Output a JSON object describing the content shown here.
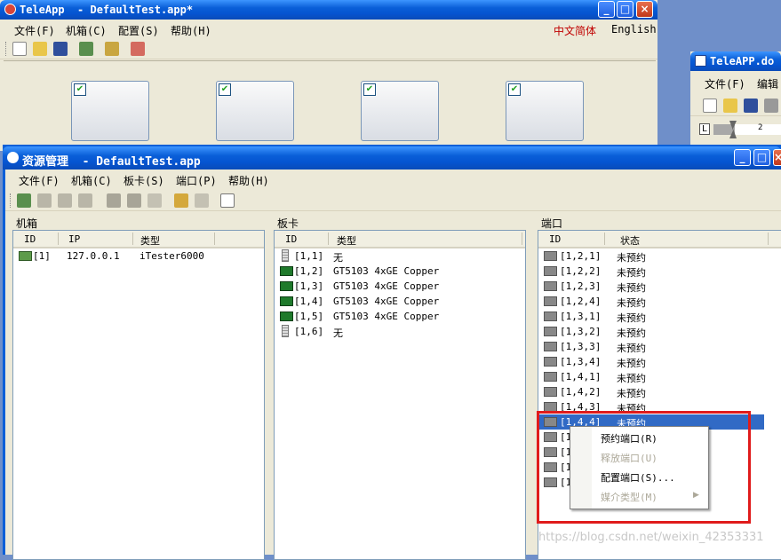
{
  "back_window": {
    "title": "TeleApp  - DefaultTest.app*",
    "menu": [
      "文件(F)",
      "机箱(C)",
      "配置(S)",
      "帮助(H)"
    ],
    "lang_zh": "中文简体",
    "lang_en": "English"
  },
  "side_window": {
    "title": "TeleAPP.do",
    "menu": [
      "文件(F)",
      "编辑"
    ],
    "ruler_value": "2",
    "ruler_mark": "L"
  },
  "main_window": {
    "title": "资源管理  - DefaultTest.app",
    "menu": [
      "文件(F)",
      "机箱(C)",
      "板卡(S)",
      "端口(P)",
      "帮助(H)"
    ]
  },
  "chassis_pane": {
    "label": "机箱",
    "columns": [
      "ID",
      "IP",
      "类型"
    ],
    "rows": [
      {
        "id": "[1]",
        "ip": "127.0.0.1",
        "type": "iTester6000"
      }
    ]
  },
  "card_pane": {
    "label": "板卡",
    "columns": [
      "ID",
      "类型"
    ],
    "rows": [
      {
        "id": "[1,1]",
        "type": "无",
        "icon": "empty-slot-icon"
      },
      {
        "id": "[1,2]",
        "type": "GT5103 4xGE Copper",
        "icon": "card-icon"
      },
      {
        "id": "[1,3]",
        "type": "GT5103 4xGE Copper",
        "icon": "card-icon"
      },
      {
        "id": "[1,4]",
        "type": "GT5103 4xGE Copper",
        "icon": "card-icon"
      },
      {
        "id": "[1,5]",
        "type": "GT5103 4xGE Copper",
        "icon": "card-icon"
      },
      {
        "id": "[1,6]",
        "type": "无",
        "icon": "empty-slot-icon"
      }
    ]
  },
  "port_pane": {
    "label": "端口",
    "columns": [
      "ID",
      "状态"
    ],
    "rows": [
      {
        "id": "[1,2,1]",
        "status": "未预约"
      },
      {
        "id": "[1,2,2]",
        "status": "未预约"
      },
      {
        "id": "[1,2,3]",
        "status": "未预约"
      },
      {
        "id": "[1,2,4]",
        "status": "未预约"
      },
      {
        "id": "[1,3,1]",
        "status": "未预约"
      },
      {
        "id": "[1,3,2]",
        "status": "未预约"
      },
      {
        "id": "[1,3,3]",
        "status": "未预约"
      },
      {
        "id": "[1,3,4]",
        "status": "未预约"
      },
      {
        "id": "[1,4,1]",
        "status": "未预约"
      },
      {
        "id": "[1,4,2]",
        "status": "未预约"
      },
      {
        "id": "[1,4,3]",
        "status": "未预约"
      },
      {
        "id": "[1,4,4]",
        "status": "未预约",
        "selected": true
      },
      {
        "id": "[1",
        "status": ""
      },
      {
        "id": "[1",
        "status": ""
      },
      {
        "id": "[1",
        "status": ""
      },
      {
        "id": "[1",
        "status": ""
      }
    ]
  },
  "context_menu": {
    "items": [
      {
        "label": "预约端口(R)",
        "enabled": true
      },
      {
        "label": "释放端口(U)",
        "enabled": false
      },
      {
        "label": "配置端口(S)...",
        "enabled": true
      },
      {
        "label": "媒介类型(M)",
        "enabled": false,
        "submenu": true
      }
    ]
  },
  "watermark": "https://blog.csdn.net/weixin_42353331",
  "colors": {
    "selection": "#316ac5",
    "highlight_box": "#e01b1b",
    "xp_blue": "#0a5fd8",
    "face": "#ece9d8"
  }
}
